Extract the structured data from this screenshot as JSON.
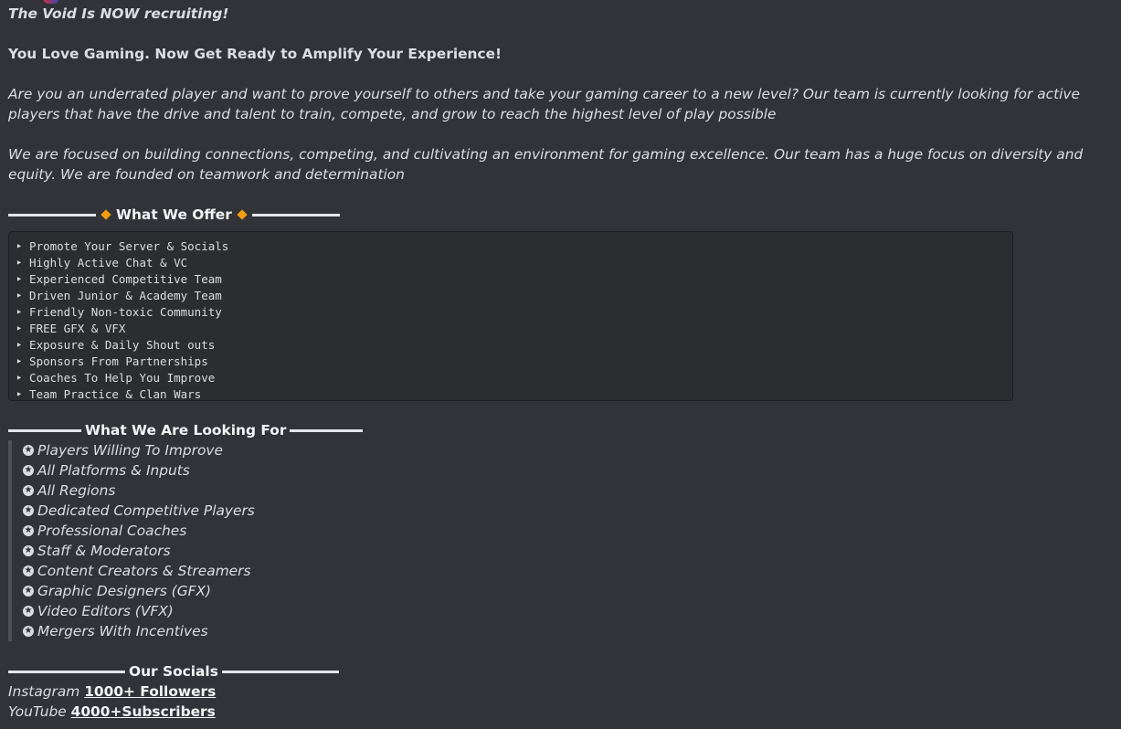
{
  "message": {
    "title": "The Void Is NOW recruiting!",
    "tagline": "You Love Gaming. Now Get Ready to Amplify Your Experience!",
    "paragraph1": "Are you an underrated player and want to prove yourself to others and take your gaming career to a new level?  Our team is currently looking for active players that have the drive and talent to train, compete, and grow to reach the highest level of play possible",
    "paragraph2": "We are focused on building connections, competing, and cultivating an environment for gaming excellence. Our team has a huge focus on diversity and equity. We are founded on teamwork and determination"
  },
  "offer": {
    "heading": "What We Offer",
    "items": [
      "‣ Promote Your Server & Socials",
      "‣ Highly Active Chat & VC",
      "‣ Experienced Competitive Team",
      "‣ Driven Junior & Academy Team",
      "‣ Friendly Non-toxic Community",
      "‣ FREE GFX & VFX",
      "‣ Exposure & Daily Shout outs",
      "‣ Sponsors From Partnerships",
      "‣ Coaches To Help You Improve",
      "‣ Team Practice & Clan Wars"
    ]
  },
  "looking": {
    "heading": "What We Are Looking For",
    "items": [
      "Players Willing To Improve",
      "All Platforms & Inputs",
      "All Regions",
      "Dedicated Competitive Players",
      "Professional Coaches",
      "Staff & Moderators",
      "Content Creators & Streamers",
      "Graphic Designers (GFX)",
      "Video Editors (VFX)",
      "Mergers With Incentives"
    ]
  },
  "socials": {
    "heading": "Our Socials",
    "instagram_label": "Instagram",
    "instagram_link": "1000+ Followers",
    "youtube_label": "YouTube",
    "youtube_link": "4000+Subscribers"
  },
  "colors": {
    "background": "#313338",
    "accent_diamond": "#f39c12"
  }
}
